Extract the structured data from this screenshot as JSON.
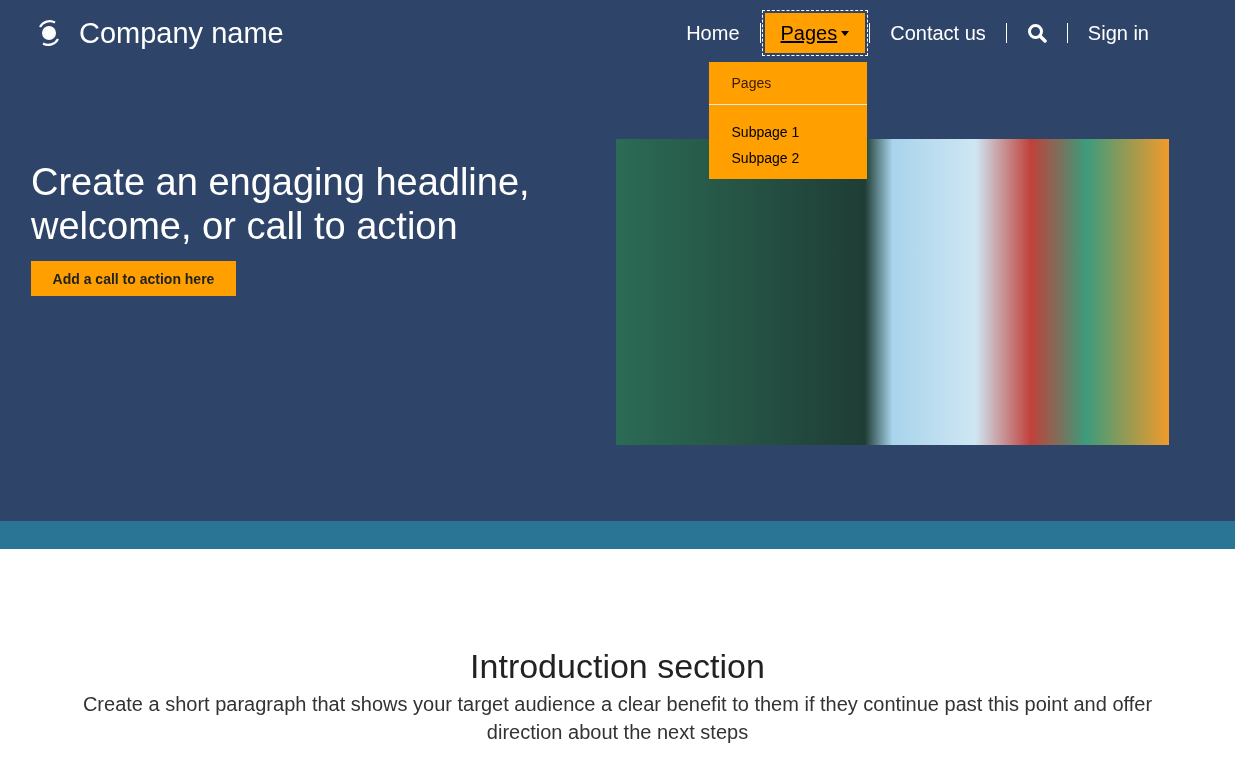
{
  "header": {
    "brand": "Company name",
    "nav": [
      {
        "kind": "link",
        "label": "Home",
        "selected": false
      },
      {
        "kind": "dropdown",
        "label": "Pages",
        "selected": true,
        "expanded": true,
        "menu": [
          {
            "kind": "heading",
            "label": "Pages"
          },
          {
            "kind": "link",
            "label": "Subpage 1"
          },
          {
            "kind": "link",
            "label": "Subpage 2"
          }
        ]
      },
      {
        "kind": "link",
        "label": "Contact us",
        "selected": false
      },
      {
        "kind": "search"
      },
      {
        "kind": "link",
        "label": "Sign in",
        "selected": false
      }
    ]
  },
  "hero": {
    "headline": "Create an engaging headline, welcome, or call to action",
    "button": "Add a call to action here"
  },
  "intro": {
    "title": "Introduction section",
    "text": "Create a short paragraph that shows your target audience a clear benefit to them if they continue past this point and offer direction about the next steps"
  }
}
